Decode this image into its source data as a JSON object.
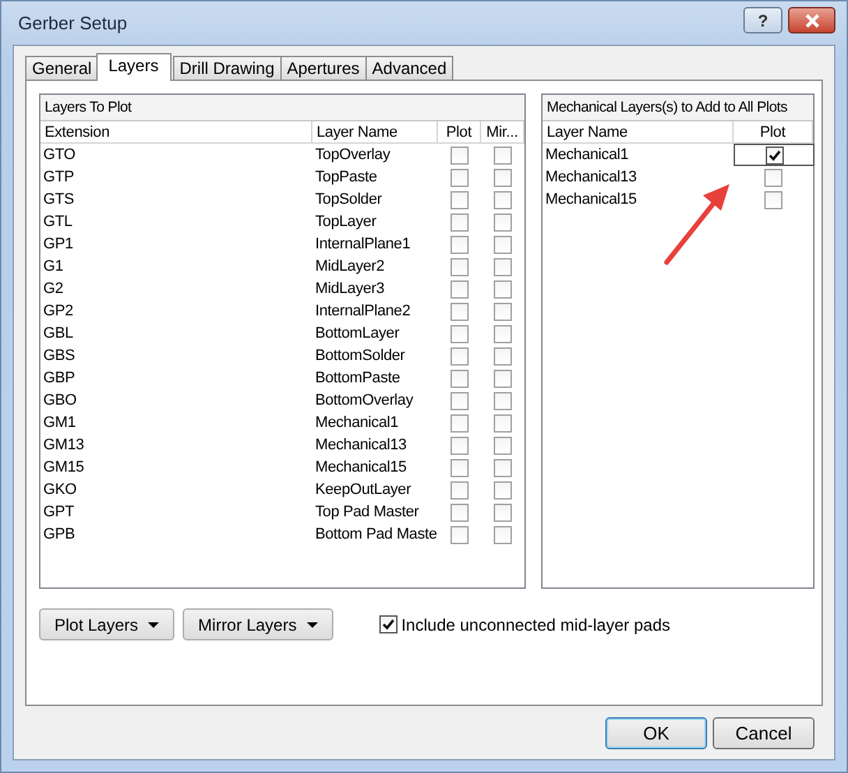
{
  "window": {
    "title": "Gerber Setup",
    "help_button": "?"
  },
  "tabs": [
    {
      "label": "General",
      "selected": false
    },
    {
      "label": "Layers",
      "selected": true
    },
    {
      "label": "Drill Drawing",
      "selected": false
    },
    {
      "label": "Apertures",
      "selected": false
    },
    {
      "label": "Advanced",
      "selected": false
    }
  ],
  "layers_to_plot": {
    "title": "Layers To Plot",
    "columns": [
      "Extension",
      "Layer Name",
      "Plot",
      "Mir..."
    ],
    "rows": [
      {
        "extension": "GTO",
        "layer_name": "TopOverlay",
        "plot": false,
        "mirror": false
      },
      {
        "extension": "GTP",
        "layer_name": "TopPaste",
        "plot": false,
        "mirror": false
      },
      {
        "extension": "GTS",
        "layer_name": "TopSolder",
        "plot": false,
        "mirror": false
      },
      {
        "extension": "GTL",
        "layer_name": "TopLayer",
        "plot": false,
        "mirror": false
      },
      {
        "extension": "GP1",
        "layer_name": "InternalPlane1",
        "plot": false,
        "mirror": false
      },
      {
        "extension": "G1",
        "layer_name": "MidLayer2",
        "plot": false,
        "mirror": false
      },
      {
        "extension": "G2",
        "layer_name": "MidLayer3",
        "plot": false,
        "mirror": false
      },
      {
        "extension": "GP2",
        "layer_name": "InternalPlane2",
        "plot": false,
        "mirror": false
      },
      {
        "extension": "GBL",
        "layer_name": "BottomLayer",
        "plot": false,
        "mirror": false
      },
      {
        "extension": "GBS",
        "layer_name": "BottomSolder",
        "plot": false,
        "mirror": false
      },
      {
        "extension": "GBP",
        "layer_name": "BottomPaste",
        "plot": false,
        "mirror": false
      },
      {
        "extension": "GBO",
        "layer_name": "BottomOverlay",
        "plot": false,
        "mirror": false
      },
      {
        "extension": "GM1",
        "layer_name": "Mechanical1",
        "plot": false,
        "mirror": false
      },
      {
        "extension": "GM13",
        "layer_name": "Mechanical13",
        "plot": false,
        "mirror": false
      },
      {
        "extension": "GM15",
        "layer_name": "Mechanical15",
        "plot": false,
        "mirror": false
      },
      {
        "extension": "GKO",
        "layer_name": "KeepOutLayer",
        "plot": false,
        "mirror": false
      },
      {
        "extension": "GPT",
        "layer_name": "Top Pad Master",
        "plot": false,
        "mirror": false
      },
      {
        "extension": "GPB",
        "layer_name": "Bottom Pad Maste",
        "plot": false,
        "mirror": false
      }
    ]
  },
  "mechanical_layers": {
    "title": "Mechanical Layers(s) to Add to All Plots",
    "columns": [
      "Layer Name",
      "Plot"
    ],
    "rows": [
      {
        "layer_name": "Mechanical1",
        "plot": true,
        "focused": true
      },
      {
        "layer_name": "Mechanical13",
        "plot": false,
        "focused": false
      },
      {
        "layer_name": "Mechanical15",
        "plot": false,
        "focused": false
      }
    ]
  },
  "dropdown_buttons": [
    {
      "label": "Plot Layers"
    },
    {
      "label": "Mirror Layers"
    }
  ],
  "include_pads": {
    "label": "Include unconnected mid-layer pads",
    "checked": true
  },
  "footer_buttons": [
    {
      "label": "OK",
      "default": true
    },
    {
      "label": "Cancel",
      "default": false
    }
  ]
}
